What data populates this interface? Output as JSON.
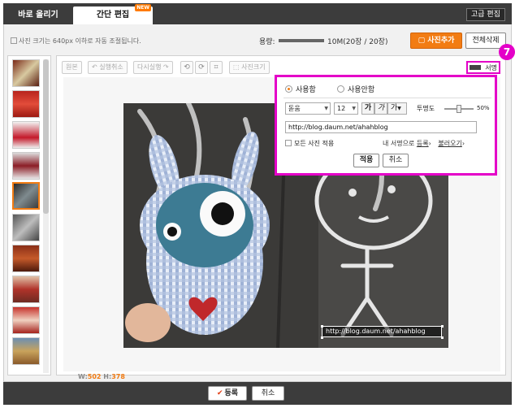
{
  "tabs": {
    "quick_upload": "바로 올리기",
    "simple_edit": "간단 편집",
    "new_badge": "NEW",
    "advanced_edit": "고급 편집"
  },
  "info": {
    "size_note": "사진 크기는 640px 이하로 자동 조절됩니다.",
    "capacity_label": "용량:",
    "capacity_fraction": 1.0,
    "capacity_text": "10M(20장 / 20장)",
    "add_photo": "사진추가",
    "delete_all": "전체삭제"
  },
  "toolbar": {
    "original": "원본",
    "undo": "실행취소",
    "redo": "다시실행",
    "rotate_left_icon": "rotate-left-icon",
    "rotate_right_icon": "rotate-right-icon",
    "crop_icon": "crop-icon",
    "photo_size": "사진크기",
    "signature": "서명"
  },
  "step_number": "7",
  "signature_panel": {
    "use": "사용함",
    "no_use": "사용안함",
    "font": "돋움",
    "size": "12",
    "bold": "가",
    "italic": "가",
    "color": "가",
    "opacity_label": "투명도",
    "opacity_fraction": 0.5,
    "opacity_value": "50%",
    "text": "http://blog.daum.net/ahahblog",
    "apply_all": "모든 사진 적용",
    "my_signature": "내 서명으로",
    "register": "등록",
    "load": "불러오기",
    "apply": "적용",
    "cancel": "취소"
  },
  "photo": {
    "signature_text": "http://blog.daum.net/ahahblog",
    "width_label": "W:",
    "width": "502",
    "height_label": "H:",
    "height": "378"
  },
  "footer": {
    "submit": "등록",
    "cancel": "취소"
  },
  "colors": {
    "accent_orange": "#f27c13",
    "highlight_magenta": "#e400c8",
    "bar_dark": "#3c3c3c"
  }
}
